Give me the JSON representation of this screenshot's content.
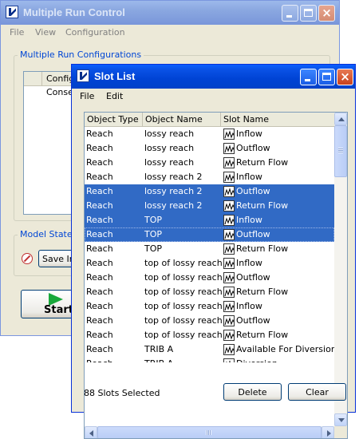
{
  "back_window": {
    "title": "Multiple Run Control",
    "menu": [
      "File",
      "View",
      "Configuration"
    ],
    "configurations_group": "Multiple Run Configurations",
    "table_header": "Configu",
    "table_row": "Consec",
    "model_state_group": "Model State",
    "save_button": "Save In",
    "start_button": "Start"
  },
  "slot_window": {
    "title": "Slot List",
    "menu": [
      "File",
      "Edit"
    ],
    "columns": [
      "Object Type",
      "Object Name",
      "Slot Name"
    ],
    "rows": [
      {
        "type": "Reach",
        "object": "lossy reach",
        "slot": "Inflow",
        "selected": false
      },
      {
        "type": "Reach",
        "object": "lossy reach",
        "slot": "Outflow",
        "selected": false
      },
      {
        "type": "Reach",
        "object": "lossy reach",
        "slot": "Return Flow",
        "selected": false
      },
      {
        "type": "Reach",
        "object": "lossy reach 2",
        "slot": "Inflow",
        "selected": false
      },
      {
        "type": "Reach",
        "object": "lossy reach 2",
        "slot": "Outflow",
        "selected": true
      },
      {
        "type": "Reach",
        "object": "lossy reach 2",
        "slot": "Return Flow",
        "selected": true
      },
      {
        "type": "Reach",
        "object": "TOP",
        "slot": "Inflow",
        "selected": true
      },
      {
        "type": "Reach",
        "object": "TOP",
        "slot": "Outflow",
        "selected": true
      },
      {
        "type": "Reach",
        "object": "TOP",
        "slot": "Return Flow",
        "selected": false
      },
      {
        "type": "Reach",
        "object": "top of lossy reach",
        "slot": "Inflow",
        "selected": false
      },
      {
        "type": "Reach",
        "object": "top of lossy reach",
        "slot": "Outflow",
        "selected": false
      },
      {
        "type": "Reach",
        "object": "top of lossy reach",
        "slot": "Return Flow",
        "selected": false
      },
      {
        "type": "Reach",
        "object": "top of lossy reach 2",
        "slot": "Inflow",
        "selected": false
      },
      {
        "type": "Reach",
        "object": "top of lossy reach 2",
        "slot": "Outflow",
        "selected": false
      },
      {
        "type": "Reach",
        "object": "top of lossy reach 2",
        "slot": "Return Flow",
        "selected": false
      },
      {
        "type": "Reach",
        "object": "TRIB A",
        "slot": "Available For Diversion",
        "selected": false
      },
      {
        "type": "Reach",
        "object": "TRIB A",
        "slot": "Diversion",
        "selected": false
      }
    ],
    "status": "88 Slots Selected",
    "delete_button": "Delete",
    "clear_button": "Clear",
    "selection_color": "#316ac5"
  }
}
